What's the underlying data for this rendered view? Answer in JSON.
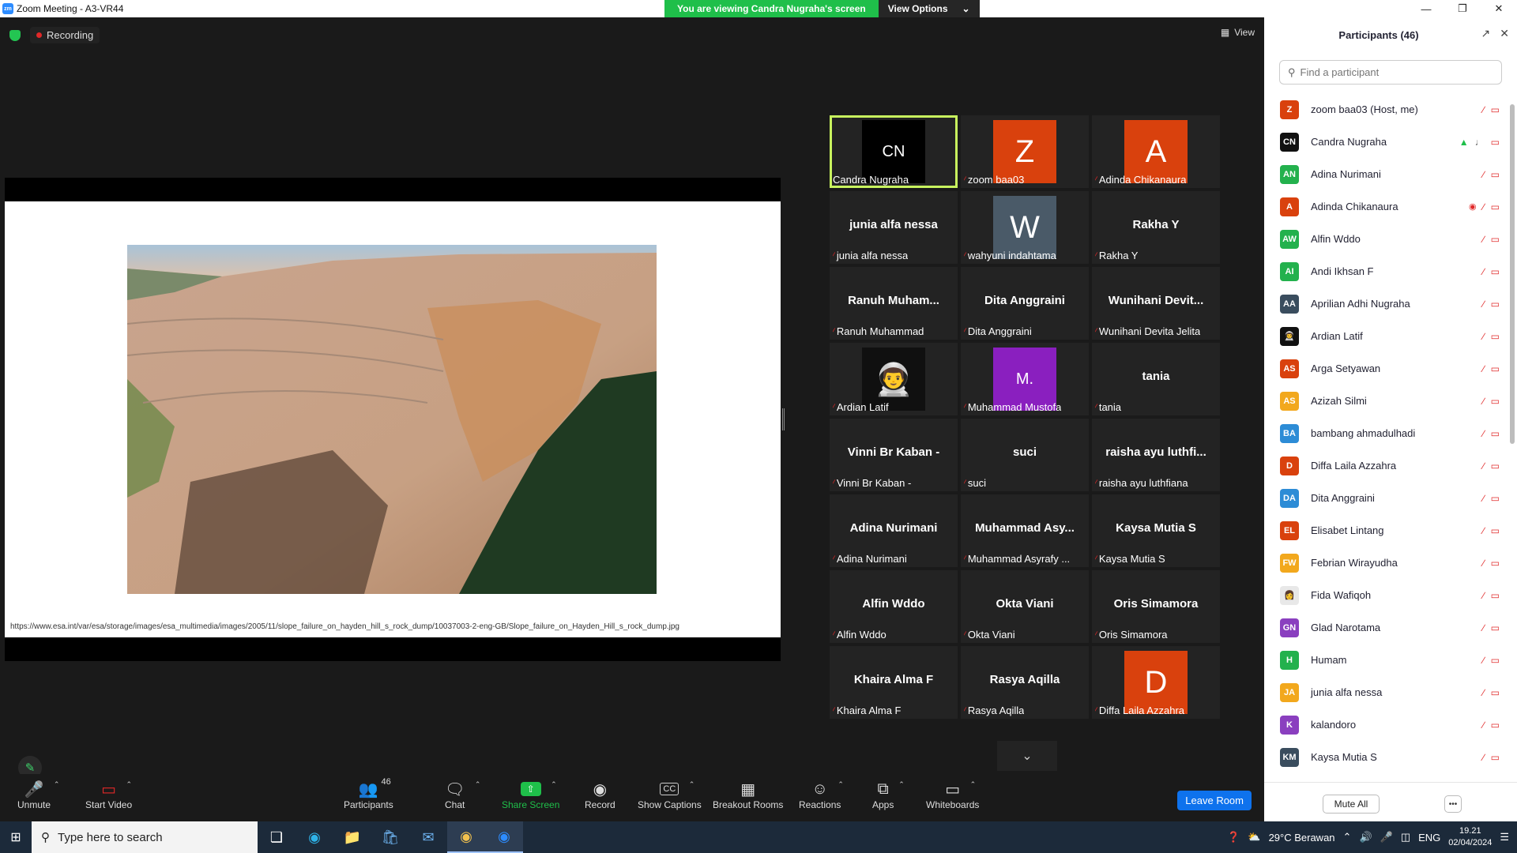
{
  "window": {
    "title": "Zoom Meeting - A3-VR44",
    "logo": "zm"
  },
  "banner": {
    "viewing_text": "You are viewing Candra Nugraha's screen",
    "view_options_label": "View Options"
  },
  "top": {
    "recording_label": "Recording",
    "view_label": "View"
  },
  "slide": {
    "url": "https://www.esa.int/var/esa/storage/images/esa_multimedia/images/2005/11/slope_failure_on_hayden_hill_s_rock_dump/10037003-2-eng-GB/Slope_failure_on_Hayden_Hill_s_rock_dump.jpg"
  },
  "gallery": {
    "tiles": [
      {
        "name": "Candra Nugraha",
        "display": "avatar",
        "initials": "CN",
        "color": "#000000",
        "active": true,
        "muted": false
      },
      {
        "name": "zoom baa03",
        "display": "avatar",
        "initials": "Z",
        "color": "#d9410d",
        "muted": true
      },
      {
        "name": "Adinda Chikanaura",
        "display": "avatar",
        "initials": "A",
        "color": "#d9410d",
        "muted": true
      },
      {
        "name": "junia alfa nessa",
        "display": "text",
        "big": "junia alfa nessa",
        "muted": true
      },
      {
        "name": "wahyuni indahtama",
        "display": "avatar",
        "initials": "W",
        "color": "#4a5a68",
        "muted": true
      },
      {
        "name": "Rakha Y",
        "display": "text",
        "big": "Rakha Y",
        "muted": true
      },
      {
        "name": "Ranuh Muhammad",
        "display": "text",
        "big": "Ranuh  Muham...",
        "muted": true
      },
      {
        "name": "Dita Anggraini",
        "display": "text",
        "big": "Dita Anggraini",
        "muted": true
      },
      {
        "name": "Wunihani Devita Jelita",
        "display": "text",
        "big": "Wunihani  Devit...",
        "muted": true
      },
      {
        "name": "Ardian Latif",
        "display": "avatar",
        "initials": "👨‍🚀",
        "color": "#101010",
        "muted": true
      },
      {
        "name": "Muhammad Mustofa",
        "display": "avatar",
        "initials": "M.",
        "color": "#8a1fbf",
        "muted": true
      },
      {
        "name": "tania",
        "display": "text",
        "big": "tania",
        "muted": true
      },
      {
        "name": "Vinni Br Kaban -",
        "display": "text",
        "big": "Vinni Br Kaban -",
        "muted": true
      },
      {
        "name": "suci",
        "display": "text",
        "big": "suci",
        "muted": true
      },
      {
        "name": "raisha ayu luthfiana",
        "display": "text",
        "big": "raisha ayu luthfi...",
        "muted": true
      },
      {
        "name": "Adina Nurimani",
        "display": "text",
        "big": "Adina Nurimani",
        "muted": true
      },
      {
        "name": "Muhammad Asyrafy ...",
        "display": "text",
        "big": "Muhammad  Asy...",
        "muted": true
      },
      {
        "name": "Kaysa Mutia S",
        "display": "text",
        "big": "Kaysa Mutia S",
        "muted": true
      },
      {
        "name": "Alfin Wddo",
        "display": "text",
        "big": "Alfin Wddo",
        "muted": true
      },
      {
        "name": "Okta Viani",
        "display": "text",
        "big": "Okta Viani",
        "muted": true
      },
      {
        "name": "Oris Simamora",
        "display": "text",
        "big": "Oris Simamora",
        "muted": true
      },
      {
        "name": "Khaira Alma F",
        "display": "text",
        "big": "Khaira Alma F",
        "muted": true
      },
      {
        "name": "Rasya Aqilla",
        "display": "text",
        "big": "Rasya Aqilla",
        "muted": true
      },
      {
        "name": "Diffa Laila Azzahra",
        "display": "avatar",
        "initials": "D",
        "color": "#d9410d",
        "muted": true
      }
    ]
  },
  "toolbar": {
    "unmute": "Unmute",
    "start_video": "Start Video",
    "participants": "Participants",
    "participants_count": "46",
    "chat": "Chat",
    "share_screen": "Share Screen",
    "record": "Record",
    "show_captions": "Show Captions",
    "breakout_rooms": "Breakout Rooms",
    "reactions": "Reactions",
    "apps": "Apps",
    "whiteboards": "Whiteboards",
    "leave": "Leave Room",
    "cc_icon": "CC"
  },
  "panel": {
    "title": "Participants (46)",
    "search_placeholder": "Find a participant",
    "mute_all": "Mute All",
    "more": "•••",
    "participants": [
      {
        "name": "zoom baa03 (Host, me)",
        "initials": "Z",
        "color": "#d9410d",
        "extra": ""
      },
      {
        "name": "Candra Nugraha",
        "initials": "CN",
        "color": "#111111",
        "extra": "share"
      },
      {
        "name": "Adina Nurimani",
        "initials": "AN",
        "color": "#23b14d",
        "extra": ""
      },
      {
        "name": "Adinda Chikanaura",
        "initials": "A",
        "color": "#d9410d",
        "extra": "rec"
      },
      {
        "name": "Alfin Wddo",
        "initials": "AW",
        "color": "#23b14d",
        "extra": ""
      },
      {
        "name": "Andi Ikhsan F",
        "initials": "AI",
        "color": "#23b14d",
        "extra": ""
      },
      {
        "name": "Aprilian Adhi Nugraha",
        "initials": "AA",
        "color": "#3a4d5e",
        "extra": ""
      },
      {
        "name": "Ardian Latif",
        "initials": "👨‍🚀",
        "color": "#111111",
        "extra": ""
      },
      {
        "name": "Arga Setyawan",
        "initials": "AS",
        "color": "#d9410d",
        "extra": ""
      },
      {
        "name": "Azizah Silmi",
        "initials": "AS",
        "color": "#f2a81d",
        "extra": ""
      },
      {
        "name": "bambang ahmadulhadi",
        "initials": "BA",
        "color": "#2d8cd6",
        "extra": ""
      },
      {
        "name": "Diffa Laila Azzahra",
        "initials": "D",
        "color": "#d9410d",
        "extra": ""
      },
      {
        "name": "Dita Anggraini",
        "initials": "DA",
        "color": "#2d8cd6",
        "extra": ""
      },
      {
        "name": "Elisabet Lintang",
        "initials": "EL",
        "color": "#d9410d",
        "extra": ""
      },
      {
        "name": "Febrian Wirayudha",
        "initials": "FW",
        "color": "#f2a81d",
        "extra": ""
      },
      {
        "name": "Fida Wafiqoh",
        "initials": "👩",
        "color": "#e8e8e8",
        "extra": ""
      },
      {
        "name": "Glad Narotama",
        "initials": "GN",
        "color": "#8a3fbf",
        "extra": ""
      },
      {
        "name": "Humam",
        "initials": "H",
        "color": "#23b14d",
        "extra": ""
      },
      {
        "name": "junia alfa nessa",
        "initials": "JA",
        "color": "#f2a81d",
        "extra": ""
      },
      {
        "name": "kalandoro",
        "initials": "K",
        "color": "#8a3fbf",
        "extra": ""
      },
      {
        "name": "Kaysa Mutia S",
        "initials": "KM",
        "color": "#3a4d5e",
        "extra": ""
      }
    ]
  },
  "taskbar": {
    "search_placeholder": "Type here to search",
    "weather": "29°C  Berawan",
    "language": "ENG",
    "time": "19.21",
    "date": "02/04/2024"
  }
}
